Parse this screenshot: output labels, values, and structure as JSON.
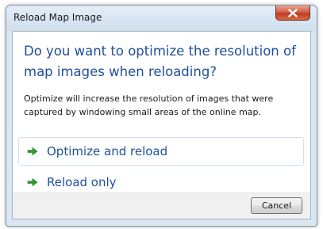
{
  "window": {
    "title": "Reload Map Image",
    "close_icon": "close-icon"
  },
  "dialog": {
    "heading": "Do you want to optimize the resolution of map images when reloading?",
    "description": "Optimize will increase the resolution of images that were captured by windowing small areas of the online map.",
    "commands": [
      {
        "label": "Optimize and reload",
        "icon": "green-arrow-icon"
      },
      {
        "label": "Reload only",
        "icon": "green-arrow-icon"
      }
    ],
    "cancel_label": "Cancel"
  },
  "colors": {
    "heading": "#1f4f9b",
    "command_arrow": "#2e9a2a",
    "close_button": "#c9482b"
  }
}
